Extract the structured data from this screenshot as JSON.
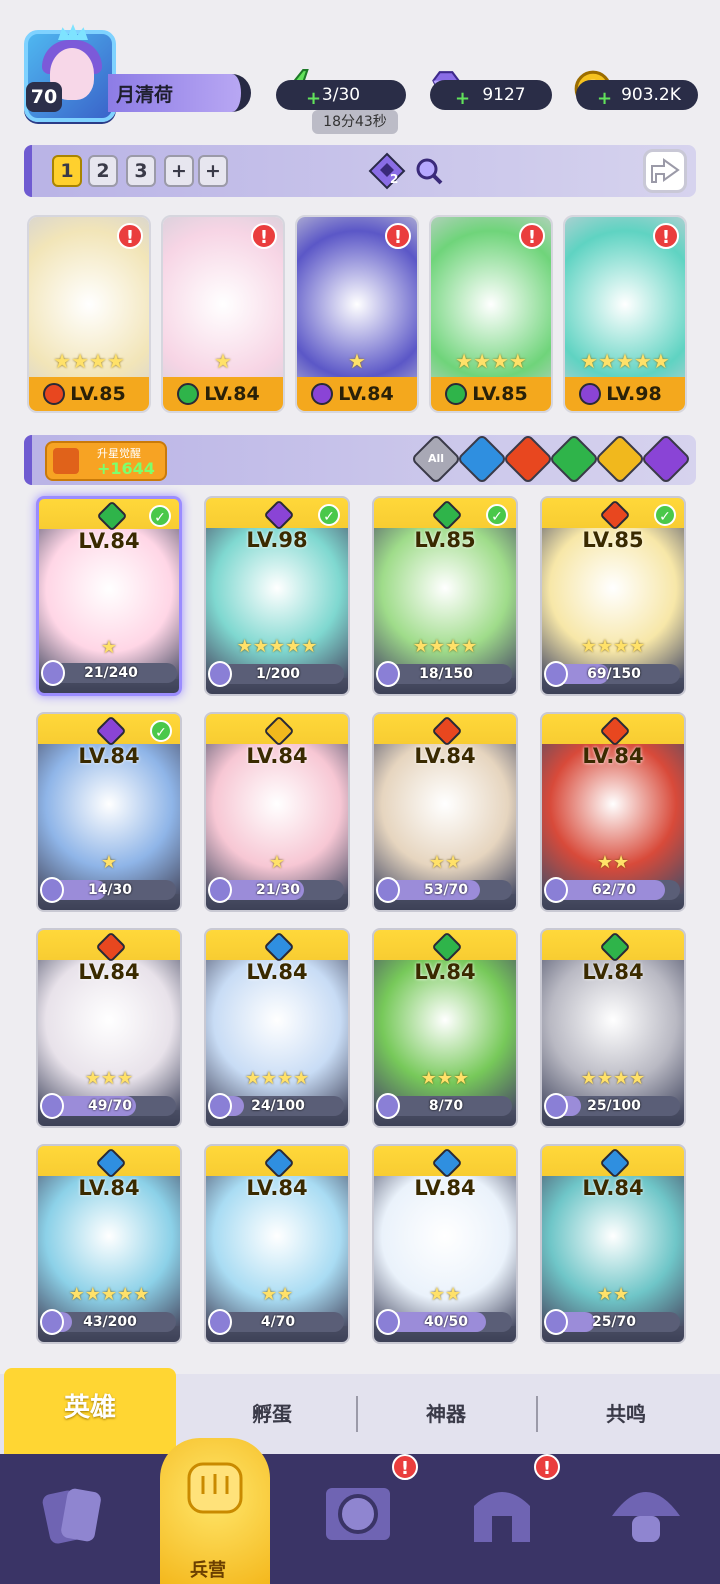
{
  "player": {
    "level": "70",
    "name": "月清荷"
  },
  "resources": {
    "energy": "3/30",
    "energy_timer": "18分43秒",
    "gems": "9127",
    "gold": "903.2K"
  },
  "team_tabs": [
    "1",
    "2",
    "3",
    "+",
    "+"
  ],
  "team_bar_badge": "2",
  "featured_heroes": [
    {
      "level": "LV.85",
      "stars": "★★★★",
      "element": "fire",
      "color": "#e8471f"
    },
    {
      "level": "LV.84",
      "stars": "★",
      "element": "wind",
      "color": "#2fb44a"
    },
    {
      "level": "LV.84",
      "stars": "★",
      "element": "dark",
      "color": "#8a44d6"
    },
    {
      "level": "LV.85",
      "stars": "★★★★",
      "element": "wind",
      "color": "#2fb44a"
    },
    {
      "level": "LV.98",
      "stars": "★★★★★",
      "element": "dark",
      "color": "#8a44d6"
    }
  ],
  "awaken": {
    "label": "升星觉醒",
    "value": "+1644"
  },
  "filters": [
    {
      "name": "all",
      "label": "All",
      "color": "#a8a8b5"
    },
    {
      "name": "water",
      "label": "",
      "color": "#2f8fe0"
    },
    {
      "name": "fire",
      "label": "",
      "color": "#e8471f"
    },
    {
      "name": "wind",
      "label": "",
      "color": "#2fb44a"
    },
    {
      "name": "light",
      "label": "",
      "color": "#f1b81d"
    },
    {
      "name": "dark",
      "label": "",
      "color": "#8a44d6"
    }
  ],
  "heroes": [
    {
      "level": "LV.84",
      "stars": "★",
      "shards": "21/240",
      "progress": 0.0875,
      "element": "#2fb44a",
      "checked": true,
      "art": "#ffd6e6"
    },
    {
      "level": "LV.98",
      "stars": "★★★★★",
      "shards": "1/200",
      "progress": 0.005,
      "element": "#8a44d6",
      "checked": true,
      "art": "#7fd8d0"
    },
    {
      "level": "LV.85",
      "stars": "★★★★",
      "shards": "18/150",
      "progress": 0.12,
      "element": "#2fb44a",
      "checked": true,
      "art": "#9fdc8a"
    },
    {
      "level": "LV.85",
      "stars": "★★★★",
      "shards": "69/150",
      "progress": 0.46,
      "element": "#e8471f",
      "checked": true,
      "art": "#f7e7a8"
    },
    {
      "level": "LV.84",
      "stars": "★",
      "shards": "14/30",
      "progress": 0.467,
      "element": "#8a44d6",
      "checked": true,
      "art": "#8fb5e8"
    },
    {
      "level": "LV.84",
      "stars": "★",
      "shards": "21/30",
      "progress": 0.7,
      "element": "#f1b81d",
      "checked": false,
      "art": "#f7c7d4"
    },
    {
      "level": "LV.84",
      "stars": "★★",
      "shards": "53/70",
      "progress": 0.757,
      "element": "#e8471f",
      "checked": false,
      "art": "#e6d5bf"
    },
    {
      "level": "LV.84",
      "stars": "★★",
      "shards": "62/70",
      "progress": 0.886,
      "element": "#e8471f",
      "checked": false,
      "art": "#d84a3a"
    },
    {
      "level": "LV.84",
      "stars": "★★★",
      "shards": "49/70",
      "progress": 0.7,
      "element": "#e8471f",
      "checked": false,
      "art": "#e8e2ea"
    },
    {
      "level": "LV.84",
      "stars": "★★★★",
      "shards": "24/100",
      "progress": 0.24,
      "element": "#2f8fe0",
      "checked": false,
      "art": "#c8dcf5"
    },
    {
      "level": "LV.84",
      "stars": "★★★",
      "shards": "8/70",
      "progress": 0.114,
      "element": "#2fb44a",
      "checked": false,
      "art": "#77c95a"
    },
    {
      "level": "LV.84",
      "stars": "★★★★",
      "shards": "25/100",
      "progress": 0.25,
      "element": "#2fb44a",
      "checked": false,
      "art": "#b9b9c3"
    },
    {
      "level": "LV.84",
      "stars": "★★★★★",
      "shards": "43/200",
      "progress": 0.215,
      "element": "#2f8fe0",
      "checked": false,
      "art": "#8cd1e8"
    },
    {
      "level": "LV.84",
      "stars": "★★",
      "shards": "4/70",
      "progress": 0.057,
      "element": "#2f8fe0",
      "checked": false,
      "art": "#a9dcf3"
    },
    {
      "level": "LV.84",
      "stars": "★★",
      "shards": "40/50",
      "progress": 0.8,
      "element": "#2f8fe0",
      "checked": false,
      "art": "#eaf2fb"
    },
    {
      "level": "LV.84",
      "stars": "★★",
      "shards": "25/70",
      "progress": 0.357,
      "element": "#2f8fe0",
      "checked": false,
      "art": "#6fc6c8"
    }
  ],
  "subtabs": [
    "英雄",
    "孵蛋",
    "神器",
    "共鸣"
  ],
  "bottom_nav": {
    "active_label": "兵营",
    "alert": "!"
  }
}
